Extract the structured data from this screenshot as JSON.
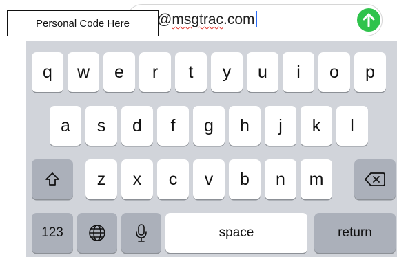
{
  "overlay": {
    "label": "Personal Code Here"
  },
  "input": {
    "prefix": "@",
    "domain": "msgtrac",
    "suffix": ".com",
    "send_icon": "arrow-up-icon",
    "send_color": "#2fc34c"
  },
  "keyboard": {
    "row1": [
      "q",
      "w",
      "e",
      "r",
      "t",
      "y",
      "u",
      "i",
      "o",
      "p"
    ],
    "row2": [
      "a",
      "s",
      "d",
      "f",
      "g",
      "h",
      "j",
      "k",
      "l"
    ],
    "row3": [
      "z",
      "x",
      "c",
      "v",
      "b",
      "n",
      "m"
    ],
    "shift_icon": "shift-icon",
    "delete_icon": "backspace-icon",
    "numbers_label": "123",
    "globe_icon": "globe-icon",
    "mic_icon": "microphone-icon",
    "space_label": "space",
    "return_label": "return",
    "background_color": "#d1d4da",
    "key_color": "#ffffff",
    "function_key_color": "#abb0ba"
  }
}
